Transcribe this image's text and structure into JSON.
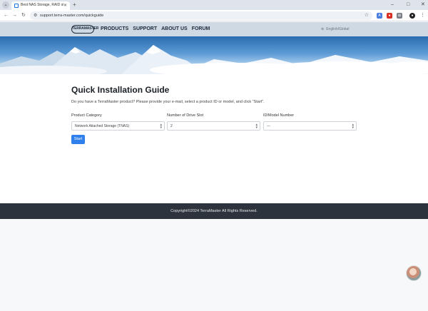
{
  "browser": {
    "tab_title": "Best NAS Storage, RAID storag",
    "url": "support.terra-master.com/quickguide",
    "new_tab_label": "+",
    "minimize_label": "–",
    "maximize_label": "□",
    "close_label": "✕"
  },
  "site": {
    "logo_text": "TERRAMASTER",
    "menu": [
      "PRODUCTS",
      "SUPPORT",
      "ABOUT US",
      "FORUM"
    ],
    "language": "English/Global"
  },
  "page": {
    "title": "Quick Installation Guide",
    "intro": "Do you have a TerraMaster product? Please provide your e-mail, select a product ID or model, and click \"Start\".",
    "fields": [
      {
        "label": "Product Category",
        "value": "Network Attached Storage (TNAS)"
      },
      {
        "label": "Number of Drive Slot",
        "value": "2"
      },
      {
        "label": "ID/Model Number",
        "value": "---"
      }
    ],
    "start_label": "Start"
  },
  "footer": {
    "copyright": "Copyright©2024 TerraMaster All Rights Reserved."
  },
  "colors": {
    "accent": "#2f80ed",
    "footer_bg": "#2c333d",
    "nav_bg": "#cfd9e4"
  },
  "icons": {
    "tab_menu": "chevron-down-icon",
    "back": "arrow-left-icon",
    "forward": "arrow-right-icon",
    "reload": "reload-icon",
    "bookmark": "star-icon",
    "language": "globe-icon",
    "chat": "support-avatar"
  }
}
